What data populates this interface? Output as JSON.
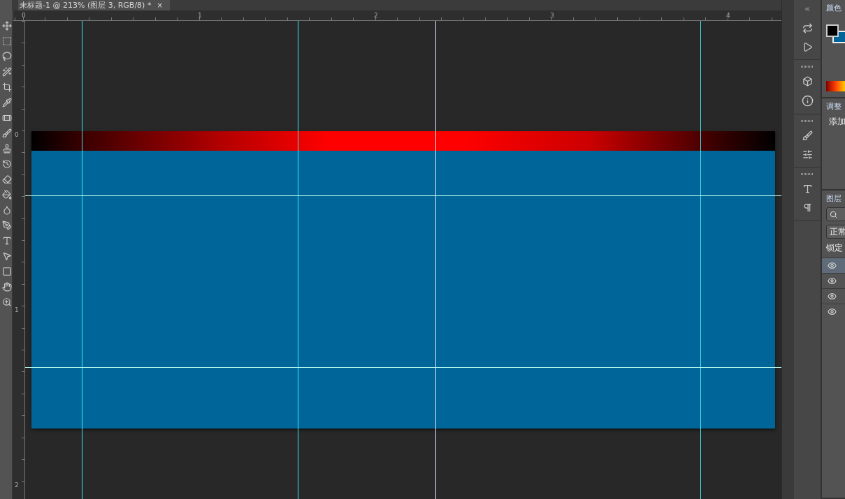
{
  "document_tab": {
    "title": "未标题-1 @ 213% (图层 3, RGB/8) *",
    "close": "×",
    "selected": true
  },
  "rulers": {
    "horizontal": [
      "0",
      "1",
      "2",
      "3",
      "4"
    ],
    "vertical": [
      "0",
      "1",
      "2"
    ]
  },
  "color_panel": {
    "title": "颜色"
  },
  "adjustments_panel": {
    "title": "调整",
    "hint": "添加"
  },
  "layers_panel": {
    "title": "图层",
    "blend_mode": "正常",
    "lock_label": "锁定",
    "layers": [
      {
        "visible": true,
        "selected": true
      },
      {
        "visible": true,
        "selected": false
      },
      {
        "visible": true,
        "selected": false
      },
      {
        "visible": true,
        "selected": false
      }
    ]
  }
}
